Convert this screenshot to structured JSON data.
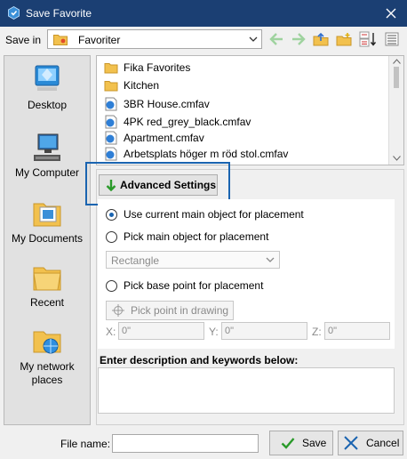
{
  "window": {
    "title": "Save Favorite",
    "icon": "app-icon",
    "close_icon": "close-icon"
  },
  "save_in": {
    "label": "Save in",
    "value": "Favoriter",
    "icon": "folder-star-icon"
  },
  "toolbar": {
    "back_icon": "arrow-left-icon",
    "forward_icon": "arrow-right-icon",
    "up_icon": "folder-up-icon",
    "new_folder_icon": "new-folder-icon",
    "sort_icon": "sort-icon"
  },
  "places": [
    {
      "label": "Desktop",
      "icon": "desktop-icon"
    },
    {
      "label": "My Computer",
      "icon": "computer-icon"
    },
    {
      "label": "My Documents",
      "icon": "documents-icon"
    },
    {
      "label": "Recent",
      "icon": "recent-folder-icon"
    },
    {
      "label": "My network places",
      "icon": "network-icon"
    }
  ],
  "files": [
    {
      "name": "Fika Favorites",
      "type": "folder"
    },
    {
      "name": "Kitchen",
      "type": "folder"
    },
    {
      "name": "3BR House.cmfav",
      "type": "file"
    },
    {
      "name": "4PK red_grey_black.cmfav",
      "type": "file"
    },
    {
      "name": "Apartment.cmfav",
      "type": "file"
    },
    {
      "name": "Arbetsplats höger m röd stol.cmfav",
      "type": "file"
    }
  ],
  "advanced": {
    "button_label": "Advanced Settings",
    "placement_options": [
      {
        "label": "Use current main object for placement",
        "selected": true
      },
      {
        "label": "Pick main object for placement",
        "selected": false
      },
      {
        "label": "Pick base point for placement",
        "selected": false
      }
    ],
    "object_dropdown": {
      "value": "Rectangle",
      "enabled": false
    },
    "pick_point_label": "Pick point in drawing",
    "coords": [
      {
        "label": "X:",
        "value": "0\""
      },
      {
        "label": "Y:",
        "value": "0\""
      },
      {
        "label": "Z:",
        "value": "0\""
      }
    ]
  },
  "description": {
    "label": "Enter description and keywords below:",
    "value": ""
  },
  "footer": {
    "file_name_label": "File name:",
    "file_name_value": "",
    "save_label": "Save",
    "cancel_label": "Cancel"
  },
  "colors": {
    "titlebar": "#1b3f73",
    "highlight": "#1a64b0",
    "save_check": "#2a9a2a",
    "cancel_x": "#1a64b0"
  }
}
